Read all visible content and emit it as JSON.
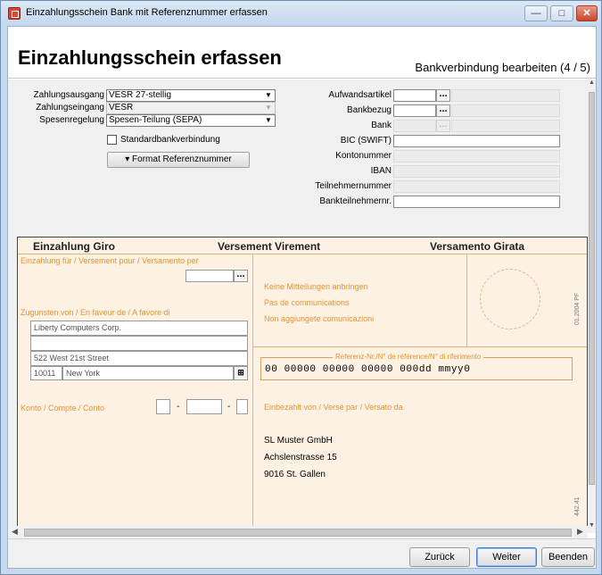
{
  "window": {
    "title": "Einzahlungsschein Bank mit Referenznummer erfassen",
    "min_glyph": "—",
    "max_glyph": "□",
    "close_glyph": "✕"
  },
  "header": {
    "title": "Einzahlungsschein erfassen",
    "step": "Bankverbindung bearbeiten (4 / 5)"
  },
  "form": {
    "zahlungsausgang_label": "Zahlungsausgang",
    "zahlungsausgang_value": "VESR 27-stellig",
    "zahlungseingang_label": "Zahlungseingang",
    "zahlungseingang_value": "VESR",
    "spesenregelung_label": "Spesenregelung",
    "spesenregelung_value": "Spesen-Teilung (SEPA)",
    "standardbank_label": "Standardbankverbindung",
    "format_button": "▾  Format Referenznummer",
    "aufwandsartikel_label": "Aufwandsartikel",
    "bankbezug_label": "Bankbezug",
    "bank_label": "Bank",
    "bic_label": "BIC (SWIFT)",
    "kontonummer_label": "Kontonummer",
    "iban_label": "IBAN",
    "teilnehmernummer_label": "Teilnehmernummer",
    "bankteilnehmernr_label": "Bankteilnehmernr.",
    "dots": "..."
  },
  "slip": {
    "header_left": "Einzahlung Giro",
    "header_mid": "Versement Virement",
    "header_right": "Versamento Girata",
    "einzahlung_fuer": "Einzahlung für / Versement pour / Versamento per",
    "zugunsten": "Zugunsten von / En faveur de / A favore di",
    "beneficiary_name": "Liberty Computers Corp.",
    "beneficiary_street": "522 West 21st Street",
    "beneficiary_zip": "10011",
    "beneficiary_city": "New York",
    "konto": "Konto / Compte / Conto",
    "dash1": "-",
    "dash2": "-",
    "mitteilung1": "Keine Mitteilungen anbringen",
    "mitteilung2": "Pas de communications",
    "mitteilung3": "Non aggiungete comunicazioni",
    "ref_label": "Referenz-Nr./N° de référence/N° di riferimento",
    "ref_number": "00 00000 00000 00000 000dd mmyy0",
    "einbezahlt": "Einbezahlt von / Versé par / Versato da",
    "payer_name": "SL Muster GmbH",
    "payer_street": "Achslenstrasse 15",
    "payer_city": "9016 St. Gallen",
    "form_code": "01.2004 PF",
    "code_442": "442.41"
  },
  "footer": {
    "back": "Zurück",
    "next": "Weiter",
    "finish": "Beenden"
  }
}
